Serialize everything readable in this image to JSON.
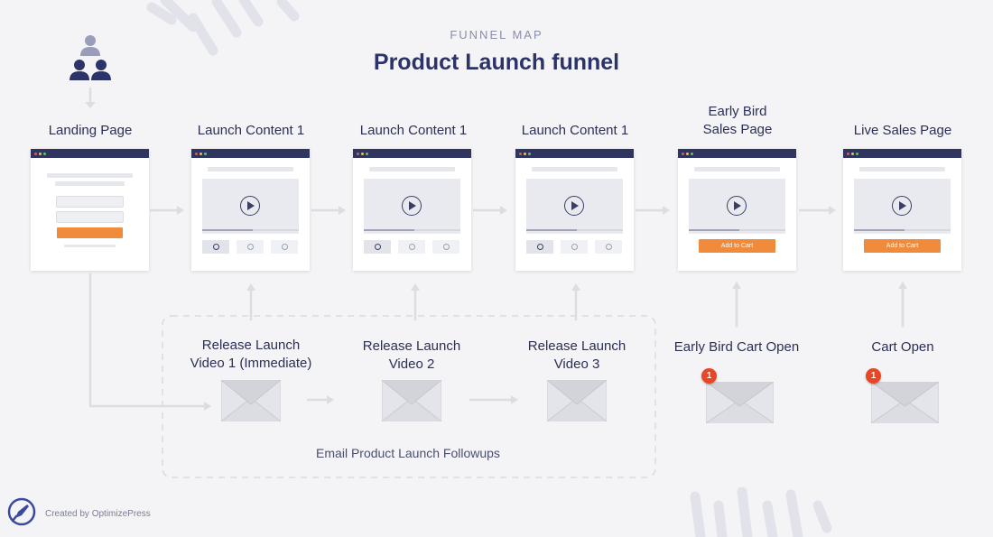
{
  "header": {
    "subtitle": "FUNNEL MAP",
    "title": "Product Launch funnel"
  },
  "steps": [
    {
      "label": "Landing Page",
      "page_type": "optin"
    },
    {
      "label": "Launch Content 1",
      "page_type": "video",
      "active_thumb": 1
    },
    {
      "label": "Launch Content 1",
      "page_type": "video",
      "active_thumb": 1
    },
    {
      "label": "Launch Content 1",
      "page_type": "video",
      "active_thumb": 1
    },
    {
      "label": "Early Bird\nSales Page",
      "page_type": "sales",
      "button_label": "Add to Cart"
    },
    {
      "label": "Live Sales Page",
      "page_type": "sales",
      "button_label": "Add to Cart"
    }
  ],
  "emails": [
    {
      "label": "Release Launch\nVideo 1 (Immediate)"
    },
    {
      "label": "Release Launch\nVideo 2"
    },
    {
      "label": "Release Launch\nVideo 3"
    },
    {
      "label": "Early Bird Cart Open",
      "badge": "1"
    },
    {
      "label": "Cart Open",
      "badge": "1"
    }
  ],
  "email_group_label": "Email Product Launch Followups",
  "footer": {
    "credit": "Created by OptimizePress"
  },
  "icons": {
    "audience": "people-group-icon",
    "email": "envelope-icon",
    "brand": "rocket-logo-icon"
  },
  "colors": {
    "navy": "#2b3368",
    "accent": "#ef8b3a",
    "badge": "#e64827",
    "connector": "#dcdde2"
  }
}
